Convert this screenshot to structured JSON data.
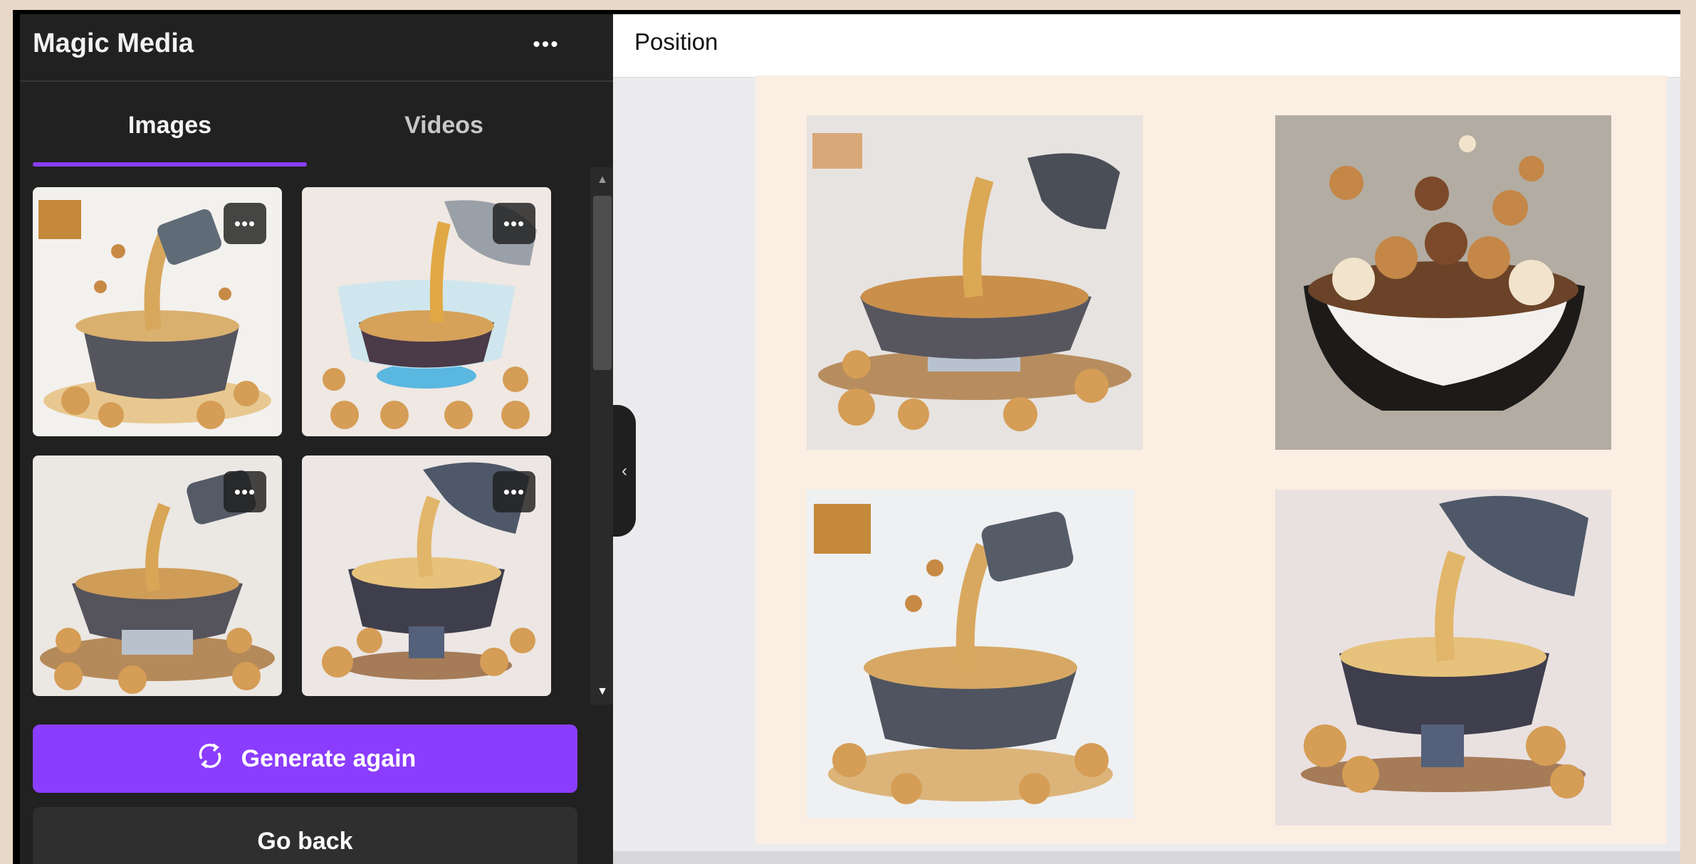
{
  "panel": {
    "title": "Magic Media",
    "more_label": "•••",
    "tabs": [
      {
        "label": "Images",
        "active": true
      },
      {
        "label": "Videos",
        "active": false
      }
    ],
    "thumbnail_more_label": "•••",
    "generate_again_label": "Generate again",
    "go_back_label": "Go back"
  },
  "editor": {
    "toolbar": {
      "position_label": "Position"
    }
  },
  "colors": {
    "accent": "#8b3dff",
    "panel_bg": "#212121",
    "canvas_bg": "#fbeee2"
  },
  "icons": {
    "refresh": "refresh-icon",
    "more": "more-horizontal-icon",
    "collapse": "chevron-left-icon"
  }
}
